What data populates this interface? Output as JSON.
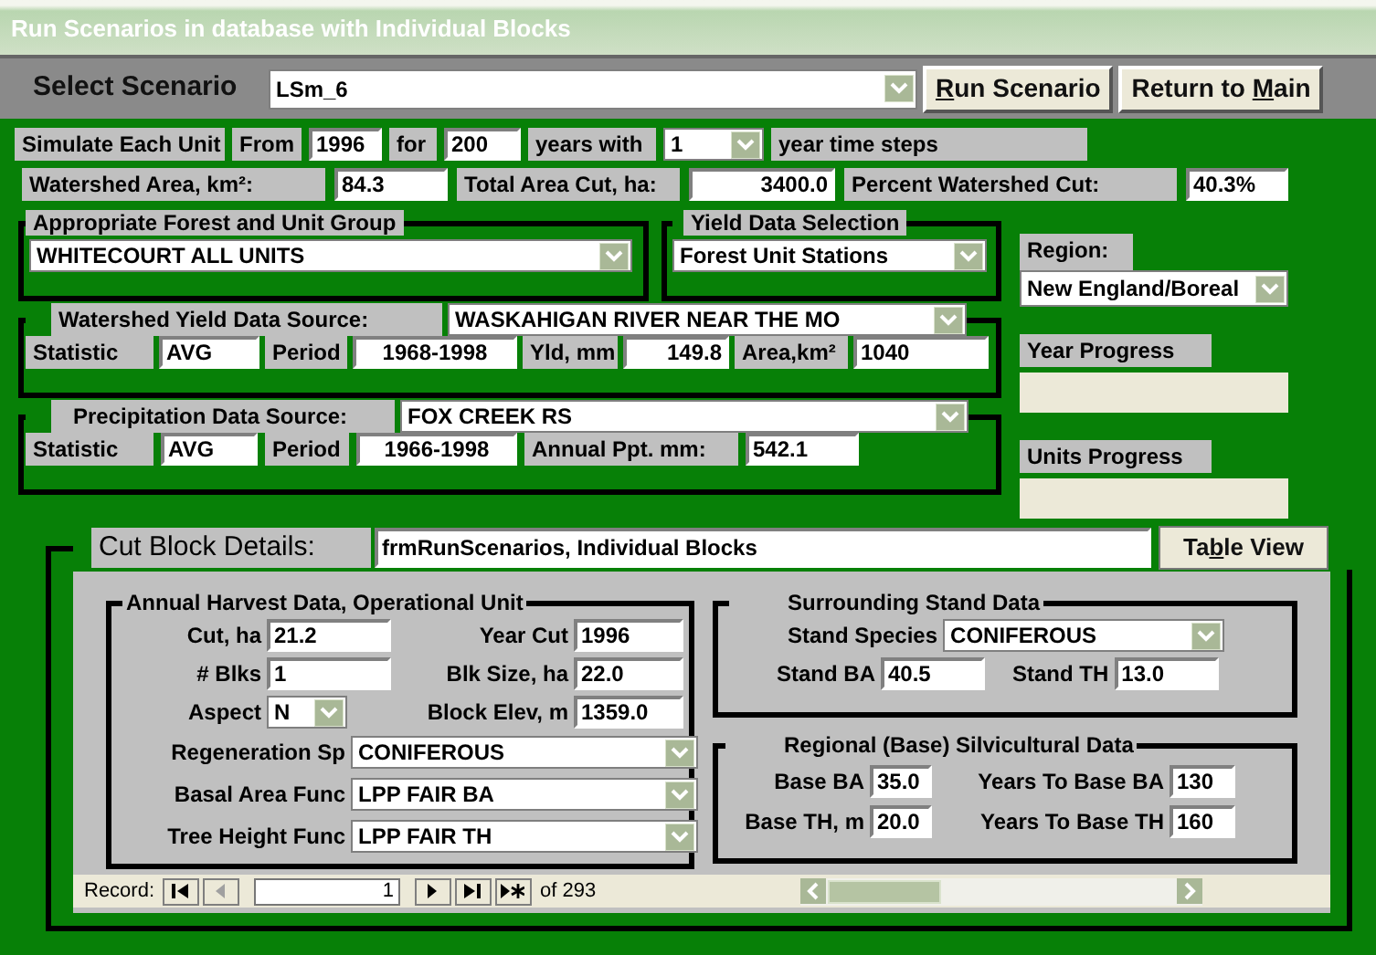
{
  "window": {
    "title": "Run Scenarios in database with Individual Blocks"
  },
  "scenario": {
    "label": "Select Scenario",
    "value": "LSm_6"
  },
  "buttons": [
    {
      "key": "R",
      "after": "un Scenario"
    },
    {
      "before": "Return to ",
      "key": "M",
      "after": "ain"
    }
  ],
  "simulate_row": [
    {
      "kind": "label",
      "text": "Simulate Each Unit"
    },
    {
      "kind": "label",
      "text": "From"
    },
    {
      "kind": "field",
      "value": "1996"
    },
    {
      "kind": "label",
      "text": "for"
    },
    {
      "kind": "field",
      "value": "200"
    },
    {
      "kind": "label",
      "text": "years with"
    },
    {
      "kind": "combo",
      "value": "1"
    },
    {
      "kind": "label",
      "text": "year time steps"
    }
  ],
  "area_row": [
    {
      "kind": "label",
      "text": "Watershed Area, km²:"
    },
    {
      "kind": "field",
      "value": "84.3"
    },
    {
      "kind": "label",
      "text": "Total Area Cut, ha:"
    },
    {
      "kind": "field",
      "value": "3400.0"
    },
    {
      "kind": "label",
      "text": "Percent Watershed Cut:"
    },
    {
      "kind": "field",
      "value": "40.3%"
    }
  ],
  "forest_group": {
    "title": "Appropriate Forest and Unit Group",
    "value": "WHITECOURT ALL UNITS"
  },
  "yield_selection": {
    "title": "Yield Data Selection",
    "value": "Forest Unit Stations"
  },
  "region": {
    "label": "Region:",
    "value": "New England/Boreal"
  },
  "watershed_yield": {
    "label": "Watershed Yield Data Source:",
    "source": "WASKAHIGAN RIVER NEAR THE MO",
    "fields": [
      {
        "label": "Statistic",
        "value": "AVG"
      },
      {
        "label": "Period",
        "value": "1968-1998"
      },
      {
        "label": "Yld, mm",
        "value": "149.8"
      },
      {
        "label": "Area,km²",
        "value": "1040"
      }
    ]
  },
  "precipitation": {
    "label": "Precipitation Data Source:",
    "source": "FOX CREEK RS",
    "fields": [
      {
        "label": "Statistic",
        "value": "AVG"
      },
      {
        "label": "Period",
        "value": "1966-1998"
      },
      {
        "label": "Annual Ppt. mm:",
        "value": "542.1"
      }
    ]
  },
  "progress": [
    {
      "label": "Year Progress"
    },
    {
      "label": "Units Progress"
    }
  ],
  "cut_block": {
    "label": "Cut Block Details:",
    "value": "frmRunScenarios, Individual Blocks",
    "button": {
      "before": "Ta",
      "key": "b",
      "after": "le View"
    }
  },
  "harvest": {
    "title": "Annual Harvest Data, Operational Unit",
    "fields": [
      {
        "kind": "field",
        "label": "Cut, ha",
        "value": "21.2"
      },
      {
        "kind": "field",
        "label": "Year Cut",
        "value": "1996"
      },
      {
        "kind": "field",
        "label": "# Blks",
        "value": "1"
      },
      {
        "kind": "field",
        "label": "Blk Size, ha",
        "value": "22.0"
      },
      {
        "kind": "combo",
        "label": "Aspect",
        "value": "N"
      },
      {
        "kind": "field",
        "label": "Block Elev, m",
        "value": "1359.0"
      }
    ],
    "selects": [
      {
        "label": "Regeneration Sp",
        "value": "CONIFEROUS"
      },
      {
        "label": "Basal Area Func",
        "value": "LPP FAIR BA"
      },
      {
        "label": "Tree Height Func",
        "value": "LPP FAIR TH"
      }
    ]
  },
  "stand": {
    "title": "Surrounding Stand Data",
    "species": {
      "label": "Stand Species",
      "value": "CONIFEROUS"
    },
    "fields": [
      {
        "label": "Stand BA",
        "value": "40.5"
      },
      {
        "label": "Stand TH",
        "value": "13.0"
      }
    ]
  },
  "regional": {
    "title": "Regional (Base) Silvicultural Data",
    "fields": [
      {
        "label": "Base BA",
        "value": "35.0"
      },
      {
        "label": "Years To Base BA",
        "value": "130"
      },
      {
        "label": "Base TH, m",
        "value": "20.0"
      },
      {
        "label": "Years To Base TH",
        "value": "160"
      }
    ]
  },
  "record_nav": {
    "label": "Record:",
    "controls": [
      {
        "kind": "first",
        "disabled": false
      },
      {
        "kind": "prev",
        "disabled": true
      },
      {
        "kind": "current",
        "value": "1"
      },
      {
        "kind": "next",
        "disabled": false
      },
      {
        "kind": "last",
        "disabled": false
      },
      {
        "kind": "new",
        "disabled": false
      }
    ],
    "total": "of 293"
  }
}
